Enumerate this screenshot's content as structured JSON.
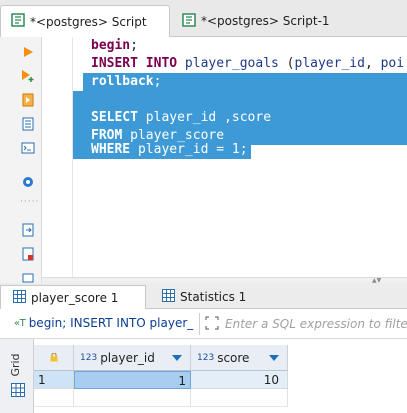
{
  "editor_tabs": [
    {
      "label": "*<postgres> Script",
      "active": true
    },
    {
      "label": "*<postgres> Script-1",
      "active": false
    }
  ],
  "toolbar": {
    "icons": [
      "execute-statement-icon",
      "execute-in-new-tab-icon",
      "execute-script-icon",
      "explain-plan-icon",
      "terminal-icon",
      "settings-icon",
      "export-icon",
      "file-icon",
      "more-icon"
    ]
  },
  "editor": {
    "lines": [
      {
        "tokens": [
          {
            "t": "begin",
            "k": "kw"
          },
          {
            "t": ";",
            "k": "p"
          }
        ]
      },
      {
        "tokens": [
          {
            "t": "INSERT INTO ",
            "k": "kw"
          },
          {
            "t": "player_goals",
            "k": "id"
          },
          {
            "t": " (",
            "k": "p"
          },
          {
            "t": "player_id",
            "k": "id"
          },
          {
            "t": ", ",
            "k": "p"
          },
          {
            "t": "poi",
            "k": "id"
          }
        ]
      },
      {
        "tokens": [
          {
            "t": "rollback",
            "k": "kw"
          },
          {
            "t": ";",
            "k": "p"
          }
        ]
      },
      {
        "tokens": []
      },
      {
        "tokens": [
          {
            "t": "SELECT ",
            "k": "kw"
          },
          {
            "t": "player_id ,score",
            "k": "p"
          }
        ]
      },
      {
        "tokens": [
          {
            "t": "FROM ",
            "k": "kw"
          },
          {
            "t": "player_score",
            "k": "p"
          }
        ]
      },
      {
        "tokens": [
          {
            "t": "WHERE ",
            "k": "kw"
          },
          {
            "t": "player_id = 1;",
            "k": "p"
          }
        ]
      }
    ]
  },
  "results_tabs": [
    {
      "label": "player_score 1",
      "active": true
    },
    {
      "label": "Statistics 1",
      "active": false
    }
  ],
  "filter": {
    "query_text": "begin; INSERT INTO player_",
    "placeholder": "Enter a SQL expression to filter re"
  },
  "grid": {
    "side_label": "Grid",
    "columns": [
      {
        "type": "123",
        "name": "player_id"
      },
      {
        "type": "123",
        "name": "score"
      }
    ],
    "rows": [
      {
        "rownum": "1",
        "cells": [
          "1",
          "10"
        ]
      }
    ]
  },
  "colors": {
    "selection": "#3d9ad6",
    "keyword": "#7a0050",
    "identifier": "#1f3a8a"
  }
}
